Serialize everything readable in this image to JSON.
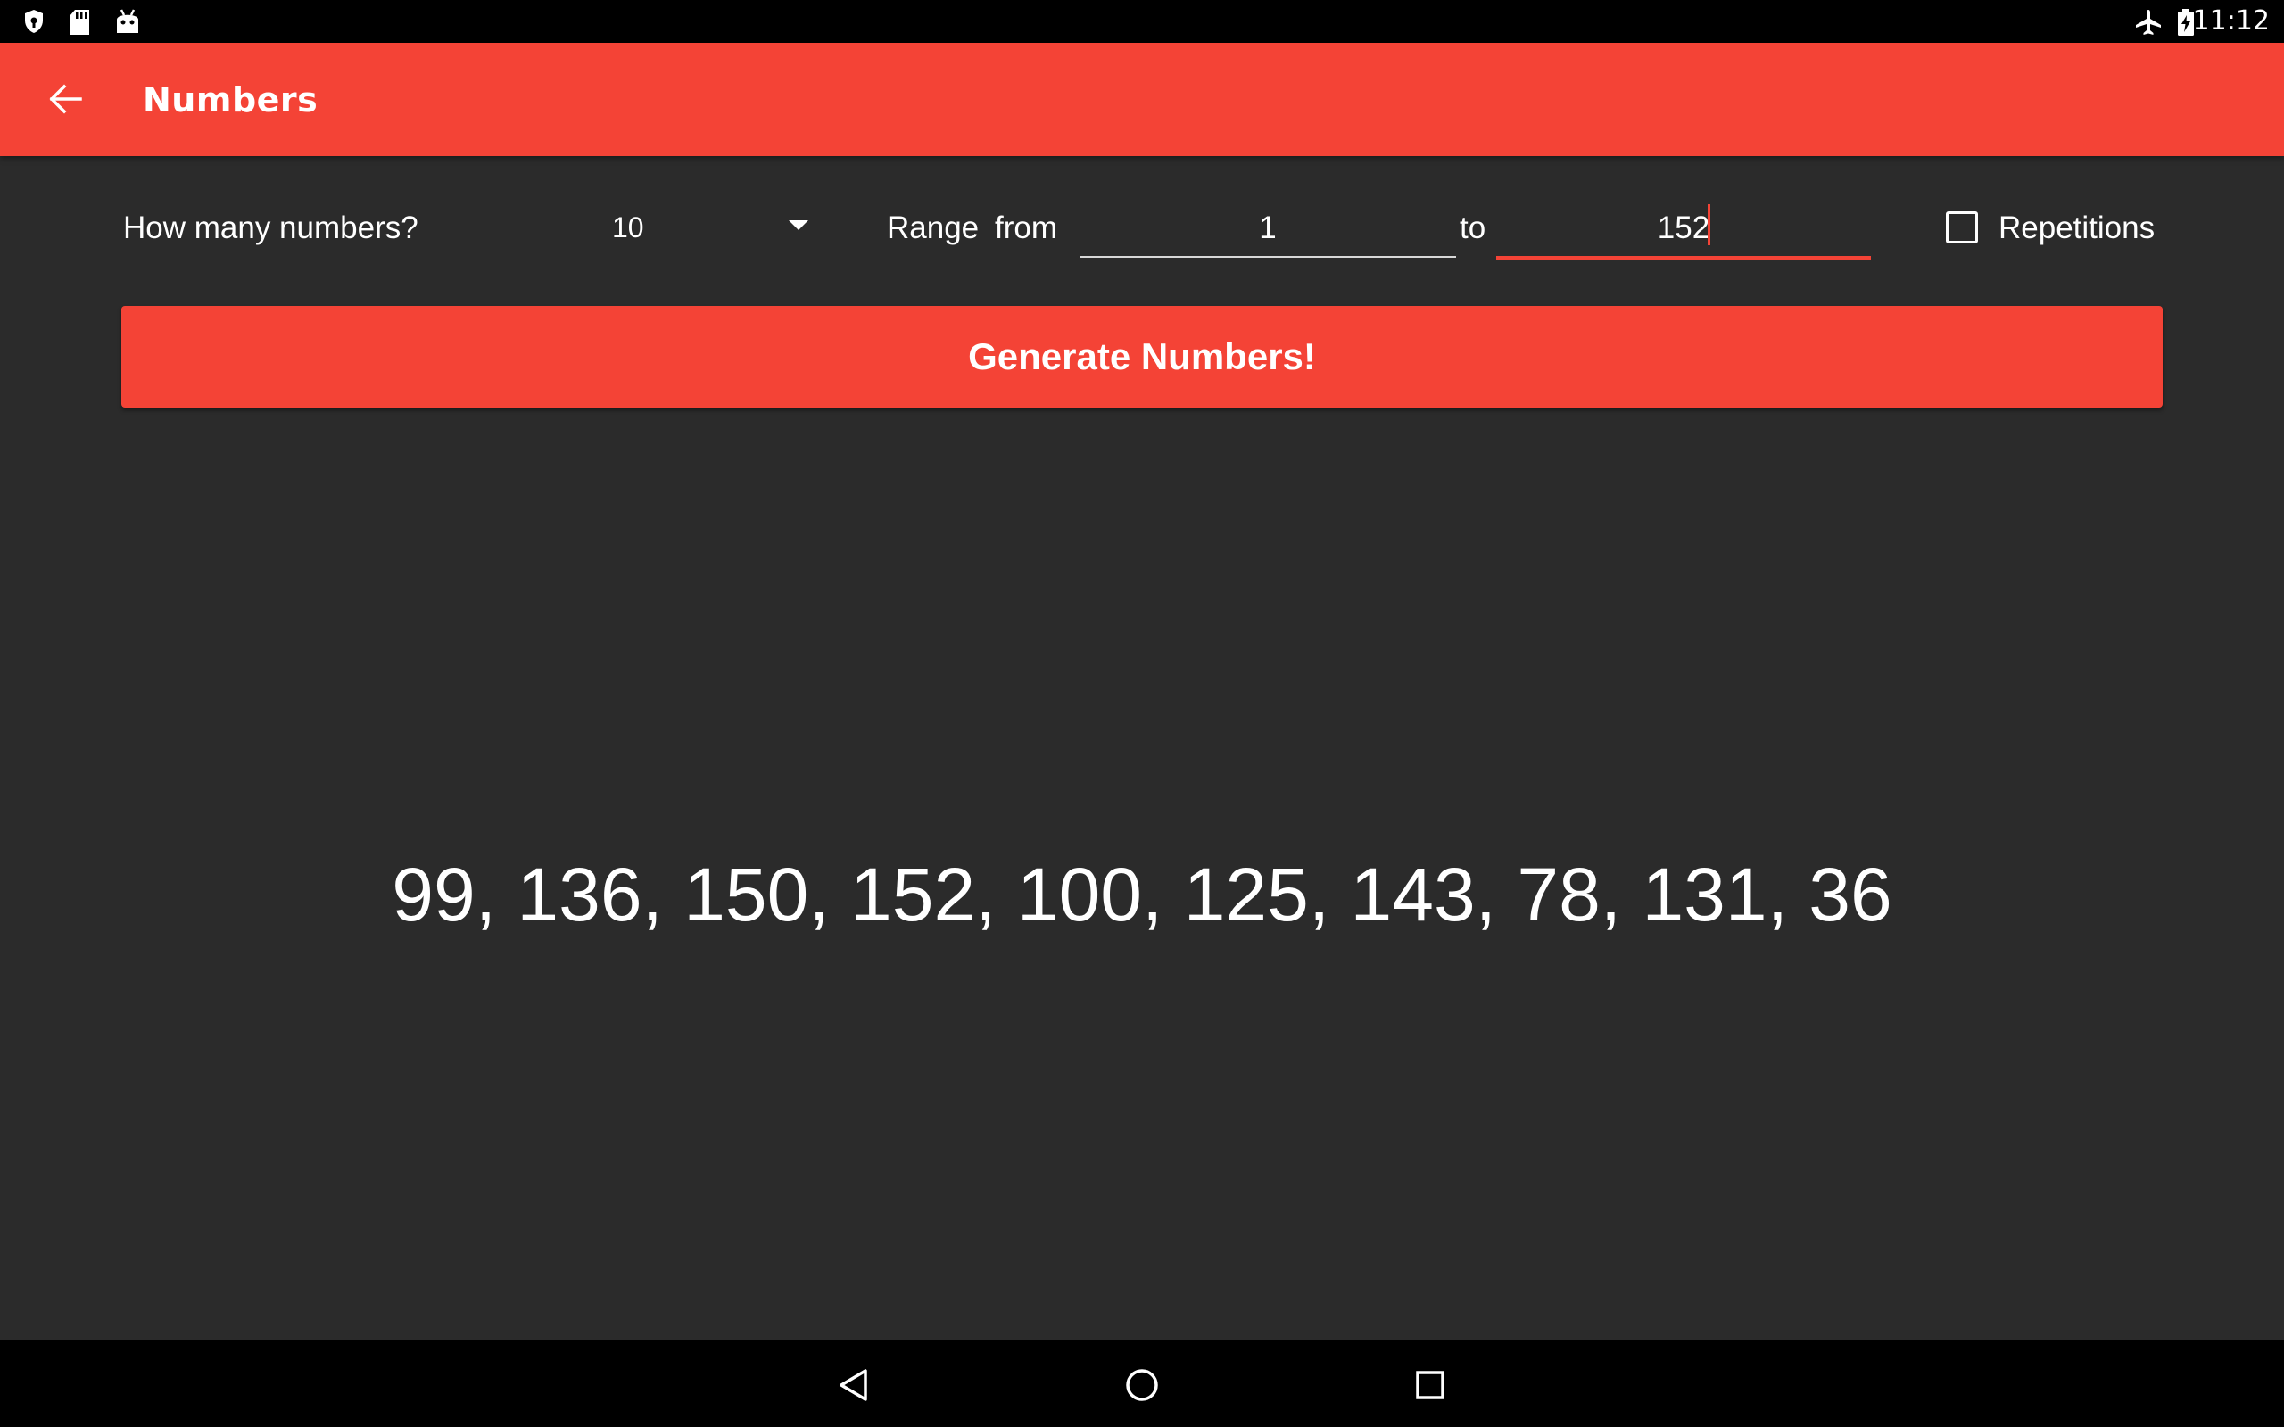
{
  "status_bar": {
    "time": "11:12",
    "left_icons": [
      "shield-icon",
      "sd-card-icon",
      "android-icon"
    ],
    "right_icons": [
      "airplane-mode-icon",
      "battery-charging-icon"
    ]
  },
  "app_bar": {
    "title": "Numbers",
    "background_color": "#f44336"
  },
  "controls": {
    "count_label": "How many numbers?",
    "count_value": "10",
    "range_label": "Range",
    "from_label": "from",
    "from_value": "1",
    "to_label": "to",
    "to_value": "152",
    "repetitions_label": "Repetitions",
    "repetitions_checked": false
  },
  "generate_button": {
    "label": "Generate Numbers!"
  },
  "result": {
    "text": "99, 136, 150, 152, 100, 125, 143, 78, 131, 36"
  },
  "nav_bar": {
    "buttons": [
      "back-icon",
      "home-icon",
      "recents-icon"
    ]
  }
}
